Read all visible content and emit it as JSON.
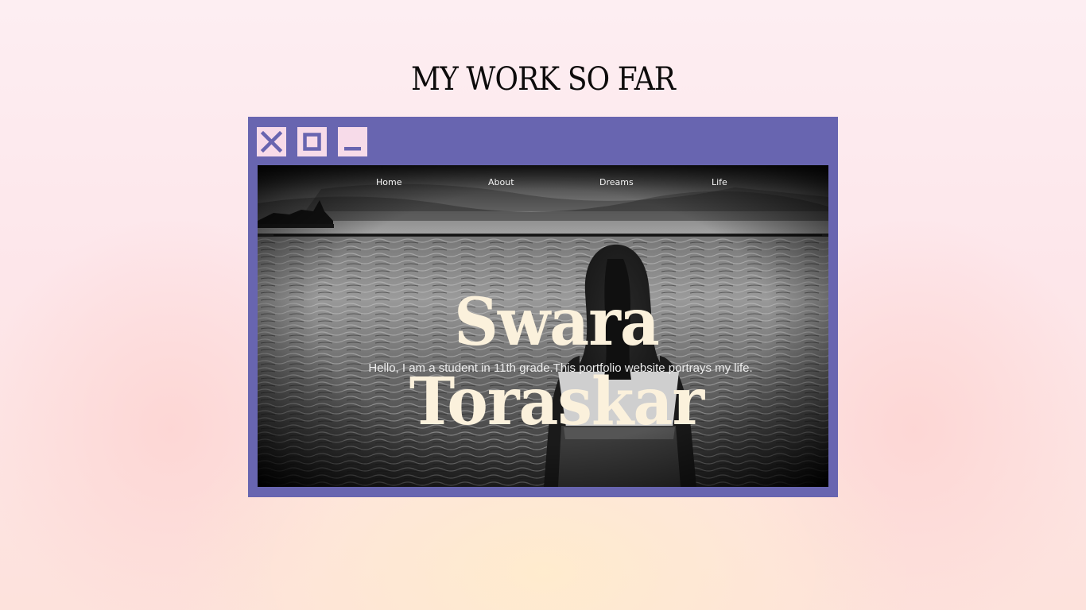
{
  "section": {
    "title": "MY WORK SO FAR"
  },
  "window": {
    "controls": {
      "close_icon": "close-x-icon",
      "maximize_icon": "maximize-square-icon",
      "minimize_icon": "minimize-bar-icon"
    },
    "frame_color": "#6865b0",
    "button_color": "#f7dbe9"
  },
  "website": {
    "nav": {
      "items": [
        "Home",
        "About",
        "Dreams",
        "Life"
      ]
    },
    "hero": {
      "name": "Swara Toraskar",
      "subtitle": "Hello, I am a student in 11th grade.This portfolio website portrays my life.",
      "name_color": "#fbf1dc"
    }
  }
}
